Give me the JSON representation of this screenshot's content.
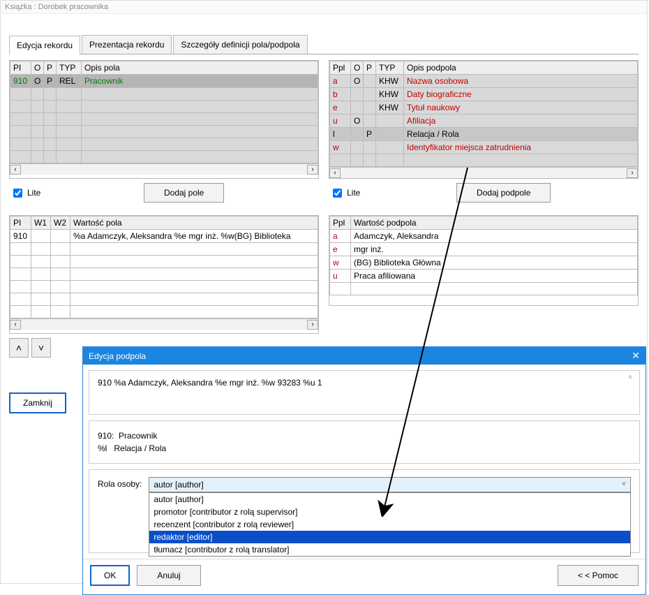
{
  "window": {
    "title": "Książka : Dorobek pracownika"
  },
  "tabs": {
    "edit": "Edycja rekordu",
    "present": "Prezentacja rekordu",
    "details": "Szczegóły definicji pola/podpola"
  },
  "left_top": {
    "headers": {
      "pi": "PI",
      "o": "O",
      "p": "P",
      "typ": "TYP",
      "desc": "Opis pola"
    },
    "row": {
      "pi": "910",
      "o": "O",
      "p": "P",
      "typ": "REL",
      "desc": "Pracownik"
    }
  },
  "right_top": {
    "headers": {
      "ppl": "Ppl",
      "o": "O",
      "p": "P",
      "typ": "TYP",
      "desc": "Opis podpola"
    },
    "rows": [
      {
        "ppl": "a",
        "o": "O",
        "p": "",
        "typ": "KHW",
        "desc": "Nazwa osobowa",
        "red": true,
        "sel": false
      },
      {
        "ppl": "b",
        "o": "",
        "p": "",
        "typ": "KHW",
        "desc": "Daty biograficzne",
        "red": true,
        "sel": false
      },
      {
        "ppl": "e",
        "o": "",
        "p": "",
        "typ": "KHW",
        "desc": "Tytuł naukowy",
        "red": true,
        "sel": false
      },
      {
        "ppl": "u",
        "o": "O",
        "p": "",
        "typ": "",
        "desc": "Afiliacja",
        "red": true,
        "sel": false
      },
      {
        "ppl": "l",
        "o": "",
        "p": "P",
        "typ": "",
        "desc": "Relacja / Rola",
        "red": false,
        "sel": true
      },
      {
        "ppl": "w",
        "o": "",
        "p": "",
        "typ": "",
        "desc": "Identyfikator miejsca zatrudnienia",
        "red": true,
        "sel": false
      }
    ]
  },
  "lite_label": "Lite",
  "buttons": {
    "add_field": "Dodaj pole",
    "add_subfield": "Dodaj podpole",
    "close": "Zamknij",
    "ok": "OK",
    "cancel": "Anuluj",
    "help": "< < Pomoc"
  },
  "left_bottom": {
    "headers": {
      "pi": "PI",
      "w1": "W1",
      "w2": "W2",
      "val": "Wartość pola"
    },
    "row": {
      "pi": "910",
      "w1": "",
      "w2": "",
      "val": "%a Adamczyk, Aleksandra %e mgr inż. %w(BG) Biblioteka"
    }
  },
  "right_bottom": {
    "headers": {
      "ppl": "Ppl",
      "val": "Wartość podpola"
    },
    "rows": [
      {
        "ppl": "a",
        "val": "Adamczyk, Aleksandra"
      },
      {
        "ppl": "e",
        "val": "mgr inż."
      },
      {
        "ppl": "w",
        "val": "(BG) Biblioteka Główna"
      },
      {
        "ppl": "u",
        "val": "Praca afiliowana"
      }
    ]
  },
  "modal": {
    "title": "Edycja podpola",
    "raw": "910  %a Adamczyk, Aleksandra %e mgr inż. %w 93283 %u 1",
    "field_code_label": "910:",
    "field_code_val": "Pracownik",
    "subfield_code_label": "%l",
    "subfield_code_val": "Relacja / Rola",
    "role_label": "Rola osoby:",
    "combo_selected": "autor [author]",
    "options": [
      "autor [author]",
      "promotor [contributor z rolą supervisor]",
      "recenzent [contributor z rolą reviewer]",
      "redaktor [editor]",
      "tłumacz [contributor z rolą translator]"
    ],
    "highlight_index": 3
  }
}
